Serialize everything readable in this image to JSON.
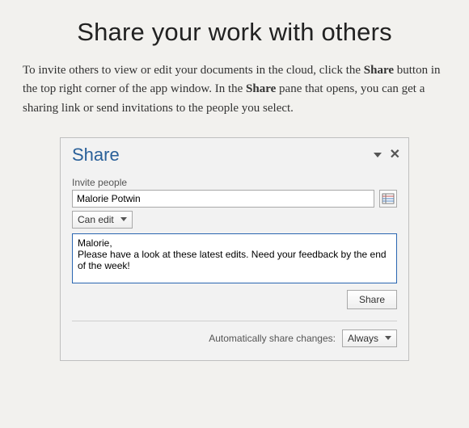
{
  "heading": "Share your work with others",
  "paragraph": {
    "prefix": "To invite others to view or edit your documents in the cloud, click the ",
    "bold1": "Share",
    "mid": " button in the top right corner of the app window. In the ",
    "bold2": "Share",
    "suffix": " pane that opens, you can get a sharing link or send invitations to the people you select."
  },
  "panel": {
    "title": "Share",
    "invite_label": "Invite people",
    "name_value": "Malorie Potwin",
    "permission": "Can edit",
    "message": "Malorie,\nPlease have a look at these latest edits. Need your feedback by the end of the week!",
    "share_button": "Share",
    "auto_label": "Automatically share changes:",
    "auto_value": "Always"
  }
}
